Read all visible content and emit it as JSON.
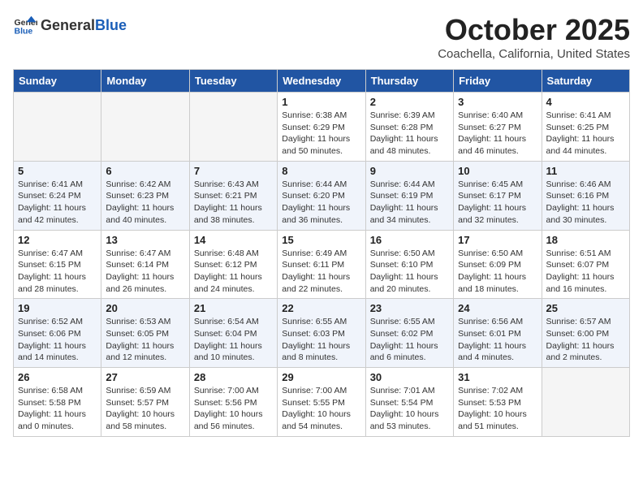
{
  "logo": {
    "general": "General",
    "blue": "Blue"
  },
  "title": "October 2025",
  "location": "Coachella, California, United States",
  "headers": [
    "Sunday",
    "Monday",
    "Tuesday",
    "Wednesday",
    "Thursday",
    "Friday",
    "Saturday"
  ],
  "weeks": [
    [
      {
        "day": "",
        "content": ""
      },
      {
        "day": "",
        "content": ""
      },
      {
        "day": "",
        "content": ""
      },
      {
        "day": "1",
        "content": "Sunrise: 6:38 AM\nSunset: 6:29 PM\nDaylight: 11 hours\nand 50 minutes."
      },
      {
        "day": "2",
        "content": "Sunrise: 6:39 AM\nSunset: 6:28 PM\nDaylight: 11 hours\nand 48 minutes."
      },
      {
        "day": "3",
        "content": "Sunrise: 6:40 AM\nSunset: 6:27 PM\nDaylight: 11 hours\nand 46 minutes."
      },
      {
        "day": "4",
        "content": "Sunrise: 6:41 AM\nSunset: 6:25 PM\nDaylight: 11 hours\nand 44 minutes."
      }
    ],
    [
      {
        "day": "5",
        "content": "Sunrise: 6:41 AM\nSunset: 6:24 PM\nDaylight: 11 hours\nand 42 minutes."
      },
      {
        "day": "6",
        "content": "Sunrise: 6:42 AM\nSunset: 6:23 PM\nDaylight: 11 hours\nand 40 minutes."
      },
      {
        "day": "7",
        "content": "Sunrise: 6:43 AM\nSunset: 6:21 PM\nDaylight: 11 hours\nand 38 minutes."
      },
      {
        "day": "8",
        "content": "Sunrise: 6:44 AM\nSunset: 6:20 PM\nDaylight: 11 hours\nand 36 minutes."
      },
      {
        "day": "9",
        "content": "Sunrise: 6:44 AM\nSunset: 6:19 PM\nDaylight: 11 hours\nand 34 minutes."
      },
      {
        "day": "10",
        "content": "Sunrise: 6:45 AM\nSunset: 6:17 PM\nDaylight: 11 hours\nand 32 minutes."
      },
      {
        "day": "11",
        "content": "Sunrise: 6:46 AM\nSunset: 6:16 PM\nDaylight: 11 hours\nand 30 minutes."
      }
    ],
    [
      {
        "day": "12",
        "content": "Sunrise: 6:47 AM\nSunset: 6:15 PM\nDaylight: 11 hours\nand 28 minutes."
      },
      {
        "day": "13",
        "content": "Sunrise: 6:47 AM\nSunset: 6:14 PM\nDaylight: 11 hours\nand 26 minutes."
      },
      {
        "day": "14",
        "content": "Sunrise: 6:48 AM\nSunset: 6:12 PM\nDaylight: 11 hours\nand 24 minutes."
      },
      {
        "day": "15",
        "content": "Sunrise: 6:49 AM\nSunset: 6:11 PM\nDaylight: 11 hours\nand 22 minutes."
      },
      {
        "day": "16",
        "content": "Sunrise: 6:50 AM\nSunset: 6:10 PM\nDaylight: 11 hours\nand 20 minutes."
      },
      {
        "day": "17",
        "content": "Sunrise: 6:50 AM\nSunset: 6:09 PM\nDaylight: 11 hours\nand 18 minutes."
      },
      {
        "day": "18",
        "content": "Sunrise: 6:51 AM\nSunset: 6:07 PM\nDaylight: 11 hours\nand 16 minutes."
      }
    ],
    [
      {
        "day": "19",
        "content": "Sunrise: 6:52 AM\nSunset: 6:06 PM\nDaylight: 11 hours\nand 14 minutes."
      },
      {
        "day": "20",
        "content": "Sunrise: 6:53 AM\nSunset: 6:05 PM\nDaylight: 11 hours\nand 12 minutes."
      },
      {
        "day": "21",
        "content": "Sunrise: 6:54 AM\nSunset: 6:04 PM\nDaylight: 11 hours\nand 10 minutes."
      },
      {
        "day": "22",
        "content": "Sunrise: 6:55 AM\nSunset: 6:03 PM\nDaylight: 11 hours\nand 8 minutes."
      },
      {
        "day": "23",
        "content": "Sunrise: 6:55 AM\nSunset: 6:02 PM\nDaylight: 11 hours\nand 6 minutes."
      },
      {
        "day": "24",
        "content": "Sunrise: 6:56 AM\nSunset: 6:01 PM\nDaylight: 11 hours\nand 4 minutes."
      },
      {
        "day": "25",
        "content": "Sunrise: 6:57 AM\nSunset: 6:00 PM\nDaylight: 11 hours\nand 2 minutes."
      }
    ],
    [
      {
        "day": "26",
        "content": "Sunrise: 6:58 AM\nSunset: 5:58 PM\nDaylight: 11 hours\nand 0 minutes."
      },
      {
        "day": "27",
        "content": "Sunrise: 6:59 AM\nSunset: 5:57 PM\nDaylight: 10 hours\nand 58 minutes."
      },
      {
        "day": "28",
        "content": "Sunrise: 7:00 AM\nSunset: 5:56 PM\nDaylight: 10 hours\nand 56 minutes."
      },
      {
        "day": "29",
        "content": "Sunrise: 7:00 AM\nSunset: 5:55 PM\nDaylight: 10 hours\nand 54 minutes."
      },
      {
        "day": "30",
        "content": "Sunrise: 7:01 AM\nSunset: 5:54 PM\nDaylight: 10 hours\nand 53 minutes."
      },
      {
        "day": "31",
        "content": "Sunrise: 7:02 AM\nSunset: 5:53 PM\nDaylight: 10 hours\nand 51 minutes."
      },
      {
        "day": "",
        "content": ""
      }
    ]
  ]
}
